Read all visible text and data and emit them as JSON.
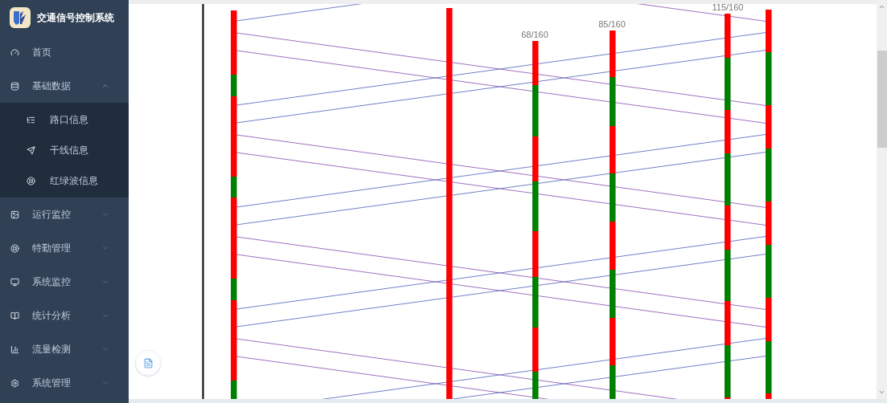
{
  "sidebar": {
    "title": "交通信号控制系统",
    "menu": [
      {
        "label": "首页"
      },
      {
        "label": "基础数据",
        "expanded": true,
        "children": [
          {
            "label": "路口信息"
          },
          {
            "label": "干线信息"
          },
          {
            "label": "红绿波信息"
          }
        ]
      },
      {
        "label": "运行监控",
        "expanded": false
      },
      {
        "label": "特勤管理",
        "expanded": false
      },
      {
        "label": "系统监控",
        "expanded": false
      },
      {
        "label": "统计分析",
        "expanded": false
      },
      {
        "label": "流量检测",
        "expanded": false
      },
      {
        "label": "系统管理",
        "expanded": false
      }
    ]
  },
  "diagram": {
    "bar_labels": [
      {
        "label": "68/160"
      },
      {
        "label": "85/160"
      },
      {
        "label": "115/160"
      }
    ]
  }
}
